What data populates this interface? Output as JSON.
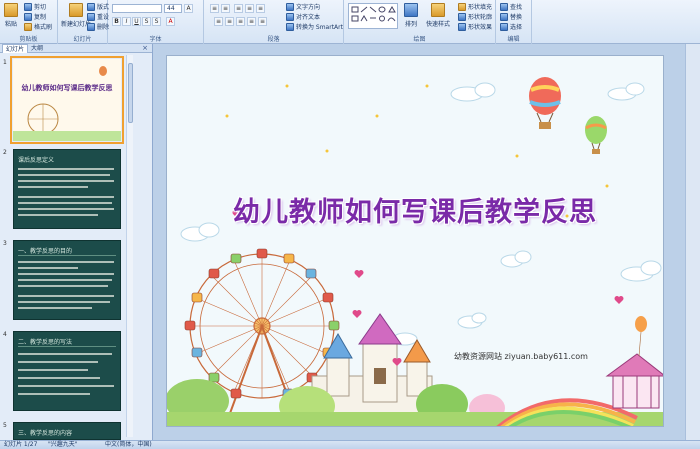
{
  "ribbon": {
    "clipboard": {
      "paste": "粘贴",
      "cut": "剪切",
      "copy": "复制",
      "format_painter": "格式刷",
      "label": "剪贴板"
    },
    "slides": {
      "new_slide": "新建幻灯片",
      "layout": "版式",
      "reset": "重设",
      "delete": "删除",
      "label": "幻灯片"
    },
    "font": {
      "size": "44",
      "label": "字体"
    },
    "paragraph": {
      "text_direction": "文字方向",
      "align_text": "对齐文本",
      "smartart": "转换为 SmartArt",
      "label": "段落"
    },
    "drawing": {
      "arrange": "排列",
      "quick_styles": "快速样式",
      "shape_fill": "形状填充",
      "shape_outline": "形状轮廓",
      "shape_effects": "形状效果",
      "label": "绘图"
    },
    "editing": {
      "find": "查找",
      "replace": "替换",
      "select": "选择",
      "label": "编辑"
    }
  },
  "panel": {
    "tabs": [
      "幻灯片",
      "大纲"
    ],
    "close": "×",
    "slides": [
      {
        "num": "1",
        "title": "幼儿教师如何写课后教学反思"
      },
      {
        "num": "2",
        "heading": "课后反思定义"
      },
      {
        "num": "3",
        "heading": "一、教学反思的目的"
      },
      {
        "num": "4",
        "heading": "二、教学反思的写法"
      },
      {
        "num": "5",
        "heading": "三、教学反思的内容"
      }
    ]
  },
  "slide": {
    "title": "幼儿教师如何写课后教学反思",
    "website": "幼教资源网站  ziyuan.baby611.com"
  },
  "status": {
    "slide_info": "幻灯片 1/27",
    "theme": "\"兴趣九天\"",
    "language": "中文(简体，中国)"
  },
  "colors": {
    "title": "#7a2aa8",
    "ribbon_bg": "#dbe7f6",
    "selection": "#f0a030",
    "dark_slide": "#1c4c4a"
  }
}
